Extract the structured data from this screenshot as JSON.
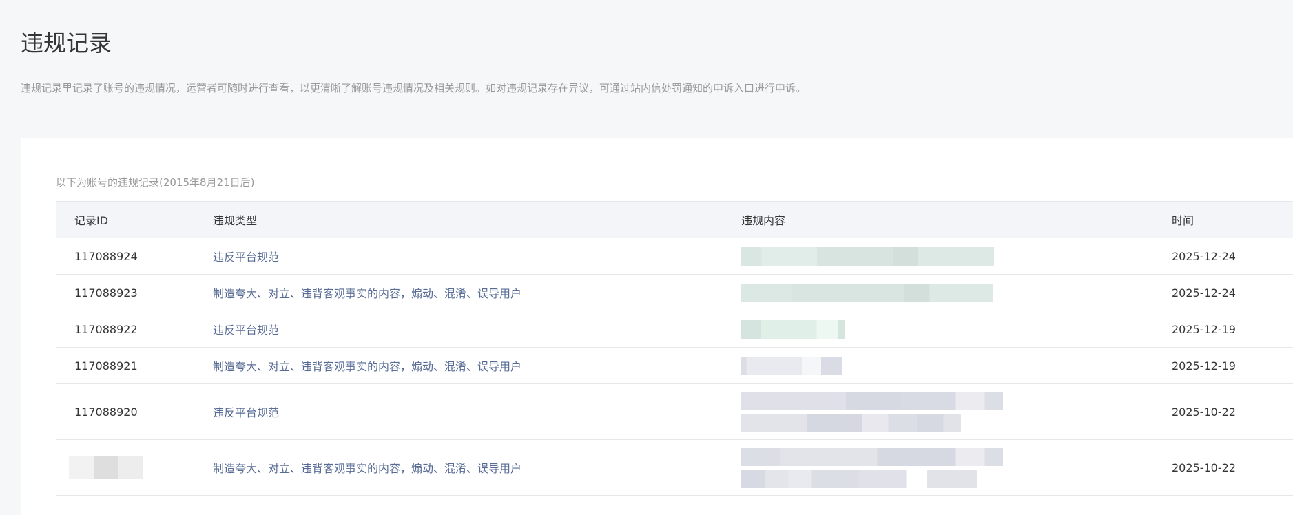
{
  "page": {
    "title": "违规记录",
    "description": "违规记录里记录了账号的违规情况，运营者可随时进行查看，以更清晰了解账号违规情况及相关规则。如对违规记录存在异议，可通过站内信处罚通知的申诉入口进行申诉。"
  },
  "records": {
    "subtitle": "以下为账号的违规记录(2015年8月21日后)",
    "columns": [
      "记录ID",
      "违规类型",
      "违规内容",
      "时间"
    ],
    "rows": [
      {
        "id": "117088924",
        "type": "违反平台规范",
        "time": "2025-12-24"
      },
      {
        "id": "117088923",
        "type": "制造夸大、对立、违背客观事实的内容，煽动、混淆、误导用户",
        "time": "2025-12-24"
      },
      {
        "id": "117088922",
        "type": "违反平台规范",
        "time": "2025-12-19"
      },
      {
        "id": "117088921",
        "type": "制造夸大、对立、违背客观事实的内容，煽动、混淆、误导用户",
        "time": "2025-12-19"
      },
      {
        "id": "117088920",
        "type": "违反平台规范",
        "time": "2025-10-22"
      },
      {
        "id": "",
        "type": "制造夸大、对立、违背客观事实的内容，煽动、混淆、误导用户",
        "time": "2025-10-22"
      }
    ]
  }
}
